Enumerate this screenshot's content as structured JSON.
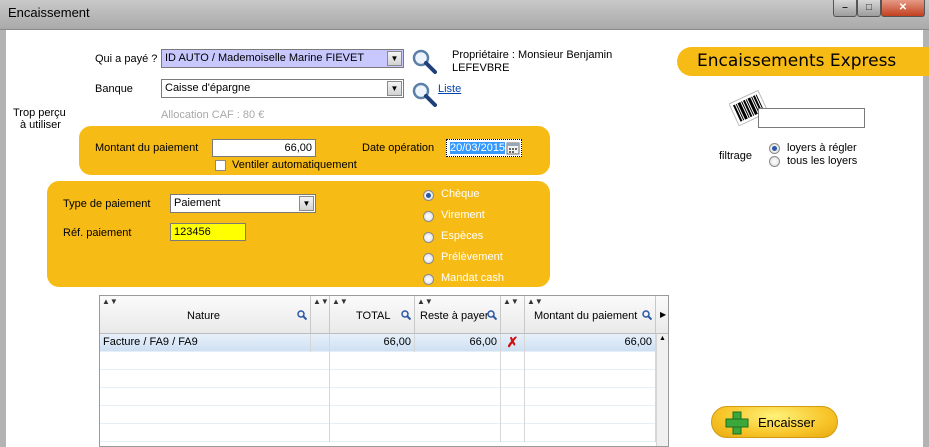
{
  "window": {
    "title": "Encaissement"
  },
  "form": {
    "payer_label": "Qui a payé ?",
    "payer_value": "ID AUTO / Mademoiselle Marine FIEVET",
    "owner_text_line1": "Propriétaire : Monsieur Benjamin",
    "owner_text_line2": "LEFEVBRE",
    "bank_label": "Banque",
    "bank_value": "Caisse d'épargne",
    "list_link": "Liste",
    "allocation_caf": "Allocation CAF : 80 €",
    "overpaid_line1": "Trop perçu",
    "overpaid_line2": "à utiliser",
    "amount_label": "Montant du paiement",
    "amount_value": "66,00",
    "date_label": "Date opération",
    "date_value": "20/03/2015",
    "split_label": "Ventiler automatiquement",
    "payment_type_label": "Type de paiement",
    "payment_type_value": "Paiement",
    "payment_ref_label": "Réf. paiement",
    "payment_ref_value": "123456",
    "methods": [
      {
        "label": "Chèque",
        "selected": true
      },
      {
        "label": "Virement",
        "selected": false
      },
      {
        "label": "Espèces",
        "selected": false
      },
      {
        "label": "Prélèvement",
        "selected": false
      },
      {
        "label": "Mandat cash",
        "selected": false
      }
    ]
  },
  "express": {
    "title": "Encaissements Express",
    "barcode_value": "",
    "filter_label": "filtrage",
    "filters": [
      {
        "label": "loyers à régler",
        "selected": true
      },
      {
        "label": "tous les loyers",
        "selected": false
      }
    ]
  },
  "grid": {
    "columns": [
      "Nature",
      "TOTAL",
      "Reste à payer",
      "Montant du paiement"
    ],
    "rows": [
      {
        "nature": "Facture / FA9 / FA9",
        "total": "66,00",
        "remaining": "66,00",
        "amount": "66,00"
      }
    ]
  },
  "actions": {
    "encaisser_label": "Encaisser"
  },
  "colors": {
    "panel": "#f7bb16",
    "highlight": "#ffff00",
    "selected_combo": "#c8c8ff"
  }
}
